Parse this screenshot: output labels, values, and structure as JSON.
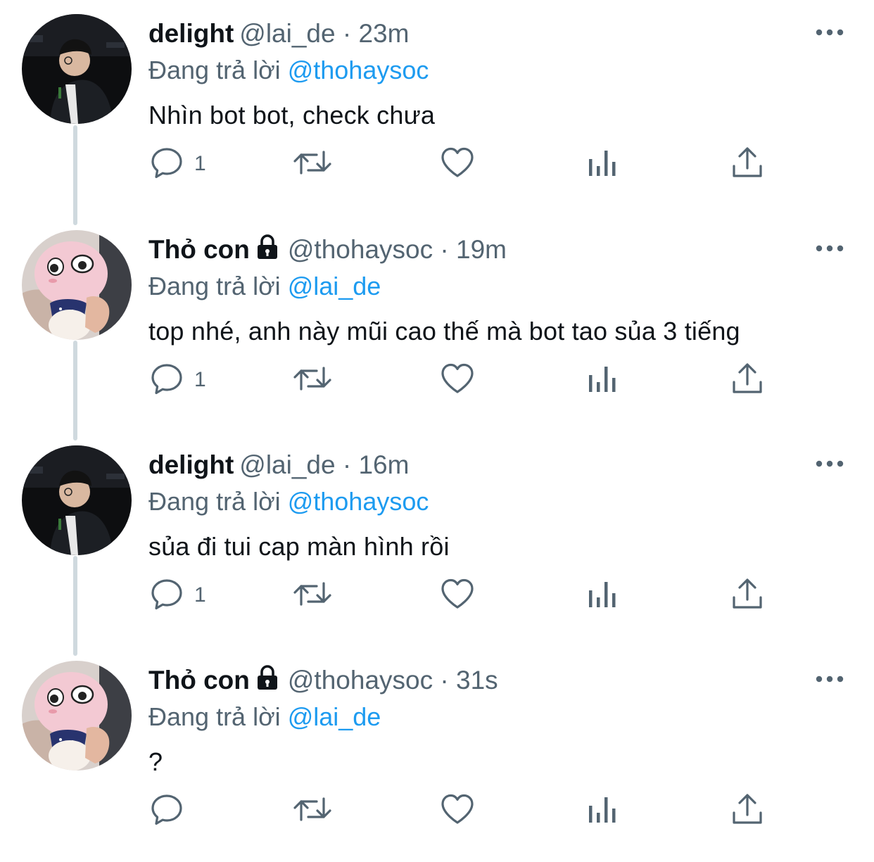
{
  "tweets": [
    {
      "name": "delight",
      "locked": false,
      "handle": "@lai_de",
      "separator": "·",
      "time": "23m",
      "replying_prefix": "Đang trả lời",
      "replying_to": "@thohaysoc",
      "text": "Nhìn bot bot, check chưa",
      "reply_count": "1",
      "avatar_icon": "profile-photo-man"
    },
    {
      "name": "Thỏ con",
      "locked": true,
      "handle": "@thohaysoc",
      "separator": "·",
      "time": "19m",
      "replying_prefix": "Đang trả lời",
      "replying_to": "@lai_de",
      "text": "top nhé, anh này mũi cao thế mà bot tao sủa 3 tiếng",
      "reply_count": "1",
      "avatar_icon": "profile-photo-plush"
    },
    {
      "name": "delight",
      "locked": false,
      "handle": "@lai_de",
      "separator": "·",
      "time": "16m",
      "replying_prefix": "Đang trả lời",
      "replying_to": "@thohaysoc",
      "text": "sủa đi tui cap màn hình rồi",
      "reply_count": "1",
      "avatar_icon": "profile-photo-man"
    },
    {
      "name": "Thỏ con",
      "locked": true,
      "handle": "@thohaysoc",
      "separator": "·",
      "time": "31s",
      "replying_prefix": "Đang trả lời",
      "replying_to": "@lai_de",
      "text": "?",
      "reply_count": "",
      "avatar_icon": "profile-photo-plush"
    }
  ],
  "icons": [
    "reply-icon",
    "retweet-icon",
    "like-icon",
    "analytics-icon",
    "share-icon",
    "more-icon",
    "lock-icon"
  ],
  "colors": {
    "mention": "#1d9bf0",
    "secondary_text": "#536471",
    "primary_text": "#0f1419",
    "thread_line": "#cfd9de"
  }
}
